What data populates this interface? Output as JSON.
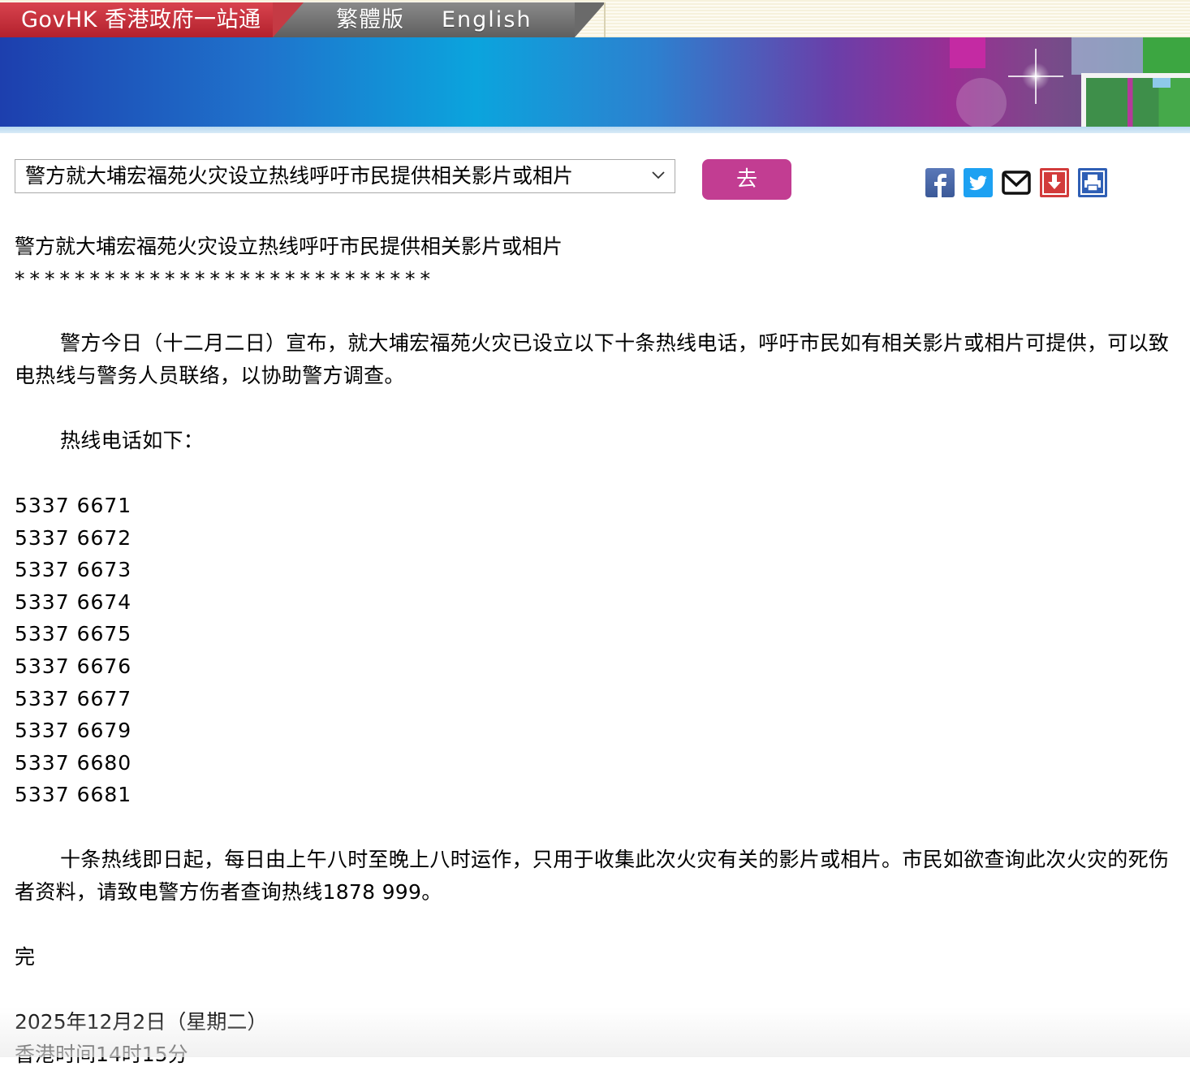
{
  "topbar": {
    "govhk_label": "GovHK 香港政府一站通",
    "lang_traditional": "繁體版",
    "lang_english": "English"
  },
  "toolbar": {
    "select_value": "警方就大埔宏福苑火灾设立热线呼吁市民提供相关影片或相片",
    "go_label": "去",
    "share_icons": [
      "facebook-icon",
      "twitter-icon",
      "email-icon",
      "download-icon",
      "print-icon"
    ],
    "colors": {
      "facebook": "#3b5998",
      "twitter": "#1da1f2",
      "download": "#d23b3b",
      "print": "#2f5fb5",
      "go_button": "#c23d92",
      "govhk_tab": "#b3212d"
    }
  },
  "article": {
    "headline": "警方就大埔宏福苑火灾设立热线呼吁市民提供相关影片或相片",
    "stars": "****************************",
    "para1": "警方今日（十二月二日）宣布，就大埔宏福苑火灾已设立以下十条热线电话，呼吁市民如有相关影片或相片可提供，可以致电热线与警务人员联络，以协助警方调查。",
    "para2": "热线电话如下：",
    "hotlines": [
      "5337 6671",
      "5337 6672",
      "5337 6673",
      "5337 6674",
      "5337 6675",
      "5337 6676",
      "5337 6677",
      "5337 6679",
      "5337 6680",
      "5337 6681"
    ],
    "para3": "十条热线即日起，每日由上午八时至晚上八时运作，只用于收集此次火灾有关的影片或相片。市民如欲查询此次火灾的死伤者资料，请致电警方伤者查询热线1878 999。",
    "end_mark": "完",
    "date": "2025年12月2日（星期二）",
    "time": "香港时间14时15分"
  }
}
